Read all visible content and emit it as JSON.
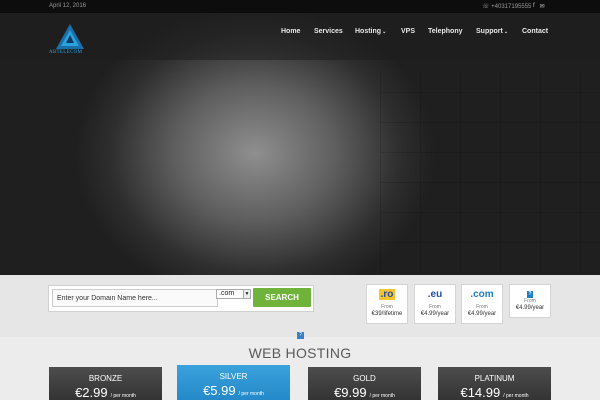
{
  "topbar": {
    "date": "April 12, 2016",
    "phone": "+40317195555",
    "social": [
      {
        "icon": "facebook-icon",
        "glyph": "f"
      },
      {
        "icon": "mail-icon",
        "glyph": "✉"
      }
    ]
  },
  "logo": {
    "text": "ABTELECOM",
    "color": "#2aa3dc"
  },
  "nav": {
    "items": [
      {
        "label": "Home"
      },
      {
        "label": "Services"
      },
      {
        "label": "Hosting"
      },
      {
        "label": "VPS"
      },
      {
        "label": "Telephony"
      },
      {
        "label": "Support"
      },
      {
        "label": "Contact"
      }
    ]
  },
  "domain_search": {
    "placeholder": "Enter your Domain Name here...",
    "tld_selected": ".com",
    "button_label": "SEARCH",
    "button_color": "#6fb33b"
  },
  "tld_offers": [
    {
      "ext": ".ro",
      "from": "From",
      "price": "€39/lifetime",
      "color": "#d9252a"
    },
    {
      "ext": ".eu",
      "from": "From",
      "price": "€4.99/year",
      "color": "#1f4fa0"
    },
    {
      "ext": ".com",
      "from": "From",
      "price": "€4.99/year",
      "color": "#1e7fc7"
    },
    {
      "ext": "",
      "from": "From",
      "price": "€4.99/year",
      "color": "#1e7fc7"
    }
  ],
  "section": {
    "title": "WEB HOSTING",
    "help_glyph": "?"
  },
  "plans": [
    {
      "name": "BRONZE",
      "price": "€2.99",
      "per": "/ per month"
    },
    {
      "name": "SILVER",
      "price": "€5.99",
      "per": "/ per month"
    },
    {
      "name": "GOLD",
      "price": "€9.99",
      "per": "/ per month"
    },
    {
      "name": "PLATINUM",
      "price": "€14.99",
      "per": "/ per month"
    }
  ]
}
